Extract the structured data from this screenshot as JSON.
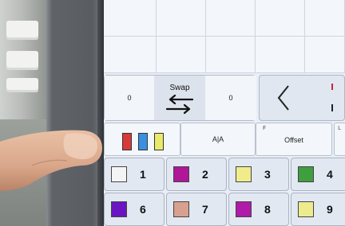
{
  "swap": {
    "left_value": "0",
    "label": "Swap",
    "right_value": "0"
  },
  "tools": {
    "aia_label": "A|A",
    "offset_key": "F",
    "offset_label": "Offset",
    "next_key": "L"
  },
  "palette": [
    {
      "num": "1",
      "color": "#f4f4f4"
    },
    {
      "num": "2",
      "color": "#b0169a"
    },
    {
      "num": "3",
      "color": "#f0ec8c"
    },
    {
      "num": "4",
      "color": "#3f9f3f"
    },
    {
      "num": "6",
      "color": "#6a14c2"
    },
    {
      "num": "7",
      "color": "#d8a08f"
    },
    {
      "num": "8",
      "color": "#b01aa8"
    },
    {
      "num": "9",
      "color": "#eceb8e"
    }
  ],
  "swatches": [
    "#d83a3a",
    "#3a8fe0",
    "#eaea6a"
  ],
  "icons": {
    "back": "chevron-left-icon",
    "swap": "swap-arrows-icon"
  },
  "accent": "#c7243a"
}
